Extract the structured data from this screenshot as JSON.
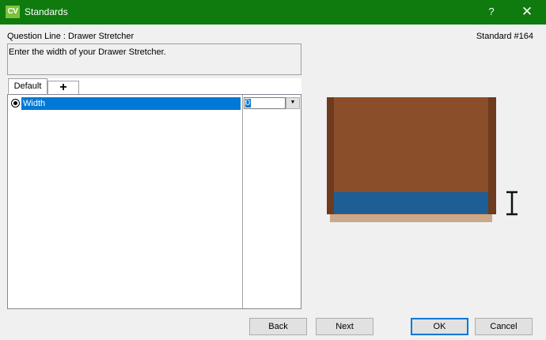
{
  "window": {
    "app_icon": "CV",
    "title": "Standards",
    "help": "?",
    "close": "✕"
  },
  "header": {
    "question_line": "Question Line : Drawer Stretcher",
    "standard_number": "Standard #164",
    "description": "Enter the width of your Drawer Stretcher."
  },
  "tabs": [
    {
      "label": "Default"
    },
    {
      "label": "+"
    }
  ],
  "grid": {
    "rows": [
      {
        "label": "Width",
        "value": "0",
        "selected": true
      }
    ],
    "dropdown_glyph": "▼"
  },
  "preview": {
    "icon": "drawer-stretcher-diagram",
    "colors": {
      "cabinet": "#8b4e2a",
      "cabinet_edge": "#6e3b1e",
      "stretcher": "#1d5f94",
      "base": "#c9a98a"
    },
    "cursor_icon": "i-beam-cursor-icon"
  },
  "footer": {
    "back_label": "Back",
    "next_label": "Next",
    "ok_label": "OK",
    "cancel_label": "Cancel"
  },
  "colors": {
    "titlebar": "#0f7b0f",
    "selection": "#0078d7",
    "app_icon": "#7cc23a"
  }
}
